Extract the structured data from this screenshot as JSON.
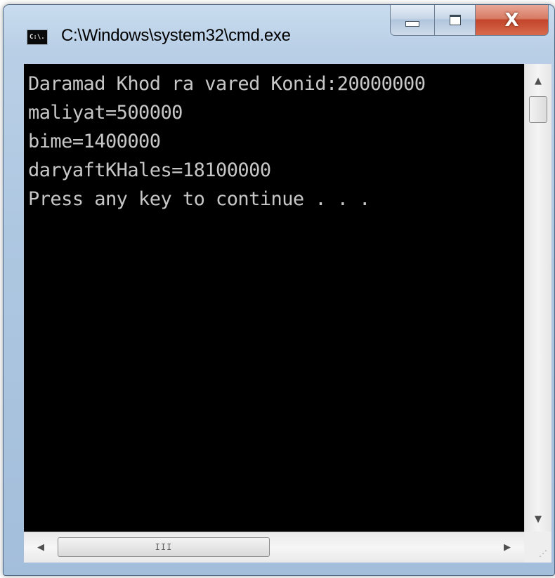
{
  "window": {
    "title": "C:\\Windows\\system32\\cmd.exe",
    "icon_label": "C:\\."
  },
  "caption_buttons": {
    "minimize_icon": "minimize-icon",
    "maximize_icon": "maximize-icon",
    "close_glyph": "X"
  },
  "console": {
    "lines": [
      "Daramad Khod ra vared Konid:20000000",
      "maliyat=500000",
      "bime=1400000",
      "daryaftKHales=18100000",
      "Press any key to continue . . ."
    ]
  },
  "scrollbar": {
    "up_glyph": "▲",
    "down_glyph": "▼",
    "left_glyph": "◀",
    "right_glyph": "▶",
    "thumb_grip": "III"
  },
  "colors": {
    "console_bg": "#000000",
    "console_fg": "#c7c7c7",
    "close_red": "#c3452a"
  }
}
